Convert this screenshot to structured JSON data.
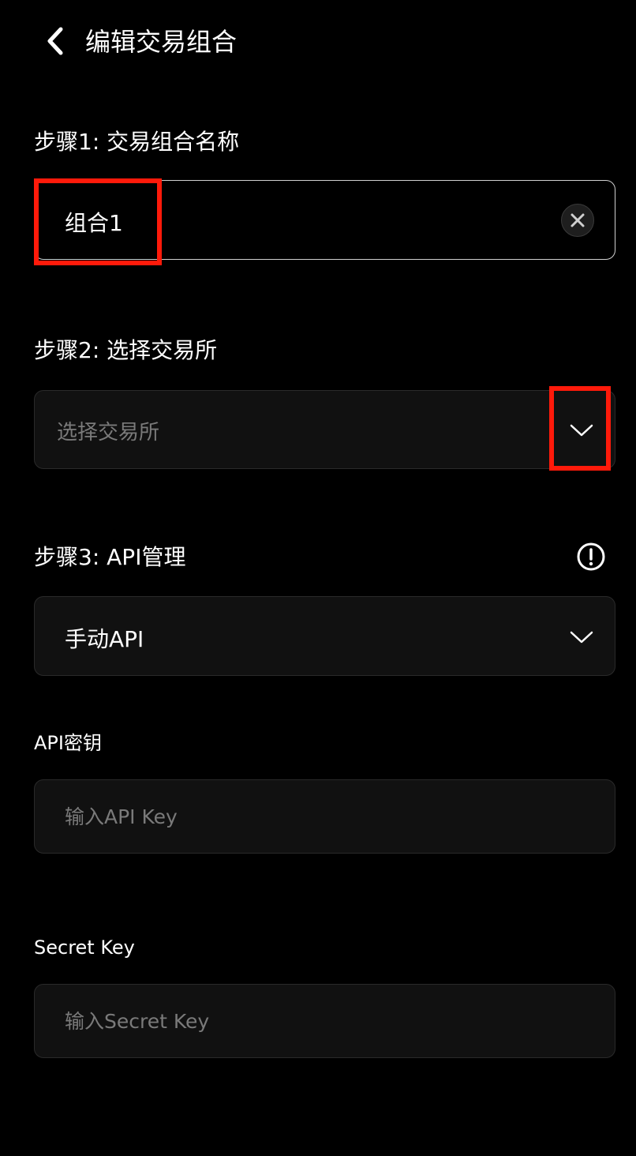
{
  "header": {
    "title": "编辑交易组合"
  },
  "step1": {
    "label": "步骤1: 交易组合名称",
    "value": "组合1"
  },
  "step2": {
    "label": "步骤2: 选择交易所",
    "placeholder": "选择交易所"
  },
  "step3": {
    "label": "步骤3: API管理",
    "selected": "手动API"
  },
  "api_key": {
    "label": "API密钥",
    "placeholder": "输入API Key"
  },
  "secret_key": {
    "label": "Secret Key",
    "placeholder": "输入Secret Key"
  },
  "colors": {
    "background": "#000000",
    "field": "#111111",
    "highlight": "#ff1a0a",
    "placeholder": "#7a7a7a"
  }
}
